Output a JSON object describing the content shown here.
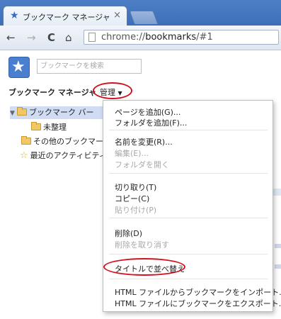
{
  "tab": {
    "title": "ブックマーク マネージャ",
    "close": "×"
  },
  "toolbar": {
    "back": "←",
    "forward": "→",
    "reload": "C",
    "home": "⌂",
    "url_scheme": "chrome://",
    "url_host": "bookmarks",
    "url_path": "/#1"
  },
  "search": {
    "placeholder": "ブックマークを検索"
  },
  "header": {
    "title": "ブックマーク マネージャ",
    "organize": "管理",
    "organize_arrow": "▼"
  },
  "tree": {
    "bookmarks_bar": "ブックマーク バー",
    "unsorted": "未整理",
    "other": "その他のブックマーク",
    "recent": "最近のアクティビティ"
  },
  "menu": {
    "add_page": "ページを追加(G)...",
    "add_folder": "フォルダを追加(F)...",
    "rename": "名前を変更(R)...",
    "edit": "編集(E)...",
    "open_folder": "フォルダを開く",
    "cut": "切り取り(T)",
    "copy": "コピー(C)",
    "paste": "貼り付け(P)",
    "delete": "削除(D)",
    "undo_delete": "削除を取り消す",
    "sort_by_title": "タイトルで並べ替え",
    "import_html": "HTML ファイルからブックマークをインポート...",
    "export_html": "HTML ファイルにブックマークをエクスポート..."
  },
  "colors": {
    "highlight_ring": "#d0131f",
    "selection": "#cfdcf3",
    "accent": "#4a7ecf"
  }
}
